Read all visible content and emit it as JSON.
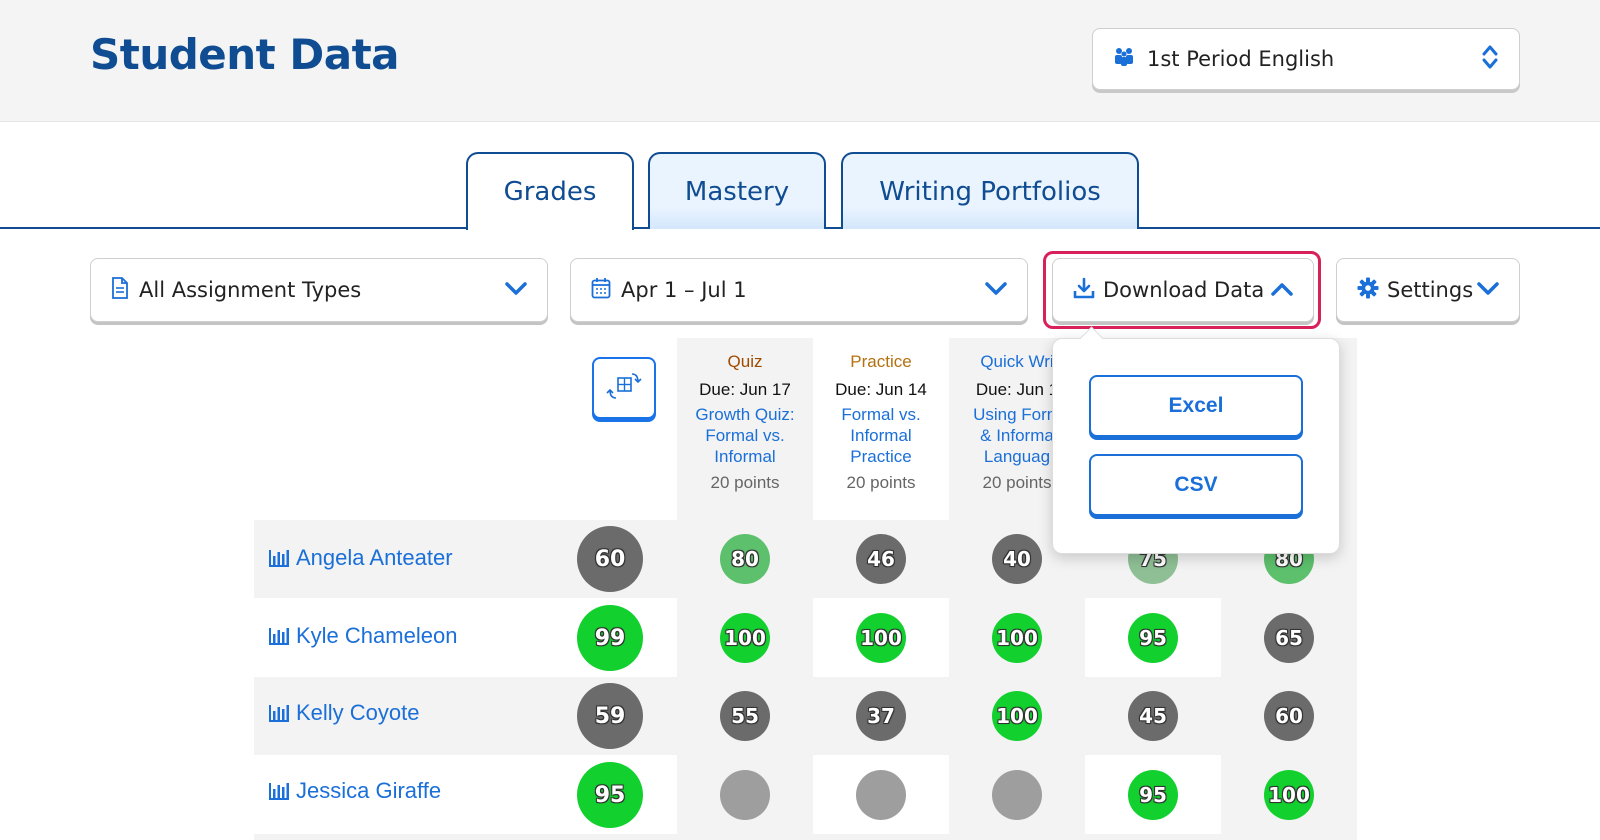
{
  "header": {
    "title": "Student Data",
    "class_selector": "1st Period English"
  },
  "tabs": [
    {
      "label": "Grades",
      "active": true
    },
    {
      "label": "Mastery",
      "active": false
    },
    {
      "label": "Writing Portfolios",
      "active": false
    }
  ],
  "filters": {
    "assignment_types": "All Assignment Types",
    "date_range": "Apr 1 – Jul 1",
    "download": "Download Data",
    "settings": "Settings"
  },
  "download_menu": {
    "excel": "Excel",
    "csv": "CSV"
  },
  "columns": [
    {
      "type": "Quiz",
      "type_color": "#a04a00",
      "due": "Due: Jun 17",
      "name_lines": [
        "Growth Quiz:",
        "Formal vs.",
        "Informal"
      ],
      "points": "20 points"
    },
    {
      "type": "Practice",
      "type_color": "#b5700f",
      "due": "Due: Jun 14",
      "name_lines": [
        "Formal vs.",
        "Informal",
        "Practice"
      ],
      "points": "20 points"
    },
    {
      "type": "Quick Wri",
      "type_color": "#1a6fd8",
      "due": "Due: Jun 1",
      "name_lines": [
        "Using Form",
        "& Informa",
        "Languag"
      ],
      "points": "20 points"
    }
  ],
  "students": [
    {
      "name": "Angela Anteater",
      "overall": "60",
      "scores": [
        "80",
        "46",
        "40",
        "75",
        "80"
      ]
    },
    {
      "name": "Kyle Chameleon",
      "overall": "99",
      "scores": [
        "100",
        "100",
        "100",
        "95",
        "65"
      ]
    },
    {
      "name": "Kelly Coyote",
      "overall": "59",
      "scores": [
        "55",
        "37",
        "100",
        "45",
        "60"
      ]
    },
    {
      "name": "Jessica Giraffe",
      "overall": "95",
      "scores": [
        "",
        "",
        "",
        "95",
        "100"
      ]
    }
  ],
  "colors": {
    "brand": "#0f4c92",
    "link": "#1a6fd8",
    "highlight": "#d8205a",
    "score_high": "#12d12f",
    "score_mid": "#5cc06c",
    "score_low": "#6b6b6b",
    "score_empty": "#9e9e9e"
  }
}
